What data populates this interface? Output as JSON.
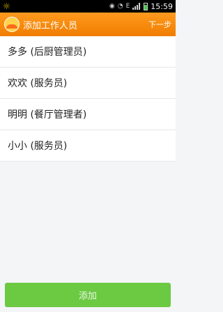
{
  "status_bar": {
    "icons": [
      "sun-icon",
      "eye-icon",
      "wifi-icon",
      "data-icon",
      "signal-icon",
      "battery-icon"
    ],
    "time": "15:59"
  },
  "app_bar": {
    "title": "添加工作人员",
    "next_label": "下一步",
    "accent_color": "#f58b0a"
  },
  "staff": [
    {
      "label": "多多 (后厨管理员)"
    },
    {
      "label": "欢欢 (服务员)"
    },
    {
      "label": "明明 (餐厅管理者)"
    },
    {
      "label": "小小 (服务员)"
    }
  ],
  "add_button": {
    "label": "添加",
    "color": "#6bc942"
  }
}
